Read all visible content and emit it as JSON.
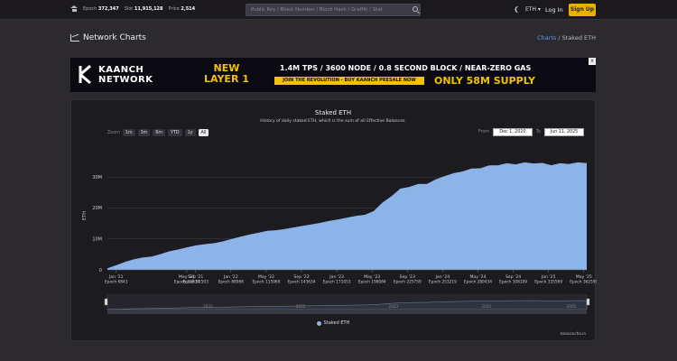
{
  "topbar": {
    "epoch_label": "Epoch",
    "epoch_value": "372,347",
    "slot_label": "Slot",
    "slot_value": "11,915,128",
    "price_label": "Price",
    "price_value": "2,514",
    "search_placeholder": "Public Key / Block Number / Block Hash / Graffiti / Stat",
    "network_select": "ETH ▾",
    "login_label": "Log In",
    "signup_label": "Sign Up"
  },
  "page": {
    "title": "Network Charts",
    "breadcrumb_link": "Charts",
    "breadcrumb_sep": "/",
    "breadcrumb_current": "Staked ETH"
  },
  "banner": {
    "brand_line1": "KAANCH",
    "brand_line2": "NETWORK",
    "new_line1": "NEW",
    "new_line2": "LAYER 1",
    "tagline": "1.4M TPS / 3600 NODE / 0.8 SECOND BLOCK / NEAR-ZERO GAS",
    "cta": "JOIN THE REVOLUTION - BUY KAANCH PRESALE NOW",
    "supply": "ONLY 58M SUPPLY",
    "ad_close": "x"
  },
  "chart_header": {
    "zoom_label": "Zoom",
    "zoom_buttons": [
      "1m",
      "3m",
      "6m",
      "YTD",
      "1y",
      "All"
    ],
    "zoom_active": "All",
    "from_label": "From",
    "from_value": "Dec 1, 2020",
    "to_label": "To",
    "to_value": "Jun 11, 2025",
    "credit": "beaconcha.in"
  },
  "colors": {
    "series": "#8db4e8",
    "accent": "#e9b000",
    "link": "#5e9ee6"
  },
  "chart_data": {
    "type": "area",
    "title": "Staked ETH",
    "subtitle": "History of daily staked ETH, which is the sum of all Effective Balances.",
    "ylabel": "ETH",
    "ylim": [
      0,
      35000000
    ],
    "yticks": [
      {
        "v": 0,
        "label": "0"
      },
      {
        "v": 10000000,
        "label": "10M"
      },
      {
        "v": 20000000,
        "label": "20M"
      },
      {
        "v": 30000000,
        "label": "30M"
      }
    ],
    "xlim": [
      0,
      54.33
    ],
    "xticks": [
      {
        "m": 1,
        "label": "Jan '21",
        "epoch": "Epoch 6843"
      },
      {
        "m": 9,
        "label": "May '21",
        "epoch": "Epoch 33834"
      },
      {
        "m": 10,
        "label": "Sep '21",
        "epoch": "Epoch 61503"
      },
      {
        "m": 14,
        "label": "Jan '22",
        "epoch": "Epoch 88968"
      },
      {
        "m": 18,
        "label": "May '22",
        "epoch": "Epoch 115969"
      },
      {
        "m": 22,
        "label": "Sep '22",
        "epoch": "Epoch 143634"
      },
      {
        "m": 26,
        "label": "Jan '23",
        "epoch": "Epoch 171053"
      },
      {
        "m": 30,
        "label": "May '23",
        "epoch": "Epoch 198084"
      },
      {
        "m": 34,
        "label": "Sep '23",
        "epoch": "Epoch 225759"
      },
      {
        "m": 38,
        "label": "Jan '24",
        "epoch": "Epoch 253219"
      },
      {
        "m": 42,
        "label": "May '24",
        "epoch": "Epoch 280434"
      },
      {
        "m": 46,
        "label": "Sep '24",
        "epoch": "Epoch 308109"
      },
      {
        "m": 50,
        "label": "Jan '25",
        "epoch": "Epoch 335569"
      },
      {
        "m": 54,
        "label": "May '25",
        "epoch": "Epoch 362599"
      }
    ],
    "navigator_labels": [
      "2021",
      "2022",
      "2023",
      "2024",
      "2025"
    ],
    "series": [
      {
        "name": "Staked ETH",
        "x": [
          "Dec 2020",
          "Jan 2021",
          "Feb 2021",
          "Mar 2021",
          "Apr 2021",
          "May 2021",
          "Jun 2021",
          "Jul 2021",
          "Aug 2021",
          "Sep 2021",
          "Oct 2021",
          "Nov 2021",
          "Dec 2021",
          "Jan 2022",
          "Feb 2022",
          "Mar 2022",
          "Apr 2022",
          "May 2022",
          "Jun 2022",
          "Jul 2022",
          "Aug 2022",
          "Sep 2022",
          "Oct 2022",
          "Nov 2022",
          "Dec 2022",
          "Jan 2023",
          "Feb 2023",
          "Mar 2023",
          "Apr 2023",
          "May 2023",
          "Jun 2023",
          "Jul 2023",
          "Aug 2023",
          "Sep 2023",
          "Oct 2023",
          "Nov 2023",
          "Dec 2023",
          "Jan 2024",
          "Feb 2024",
          "Mar 2024",
          "Apr 2024",
          "May 2024",
          "Jun 2024",
          "Jul 2024",
          "Aug 2024",
          "Sep 2024",
          "Oct 2024",
          "Nov 2024",
          "Dec 2024",
          "Jan 2025",
          "Feb 2025",
          "Mar 2025",
          "Apr 2025",
          "May 2025",
          "Jun 2025"
        ],
        "values": [
          500000,
          1500000,
          2600000,
          3400000,
          4000000,
          4300000,
          5100000,
          6000000,
          6600000,
          7300000,
          7900000,
          8300000,
          8600000,
          9200000,
          10000000,
          10700000,
          11400000,
          12000000,
          12600000,
          12800000,
          13200000,
          13700000,
          14200000,
          14700000,
          15200000,
          15800000,
          16300000,
          16900000,
          17400000,
          17800000,
          19000000,
          21500000,
          24000000,
          26000000,
          27000000,
          27500000,
          28000000,
          29000000,
          30500000,
          31000000,
          32000000,
          32500000,
          33000000,
          33500000,
          34000000,
          34200000,
          34300000,
          34500000,
          34600000,
          34300000,
          34000000,
          34200000,
          34400000,
          34500000,
          34700000
        ]
      }
    ]
  }
}
